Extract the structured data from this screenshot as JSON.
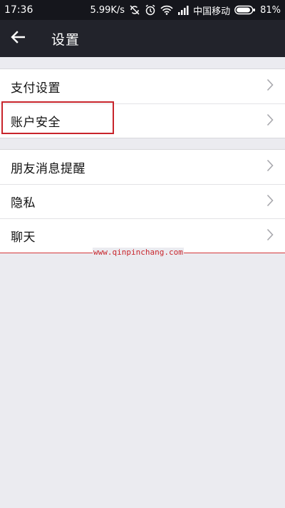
{
  "status_bar": {
    "time": "17:36",
    "speed": "5.99K/s",
    "carrier": "中国移动",
    "battery": "81%",
    "icons": [
      "sync-off-icon",
      "alarm-icon",
      "wifi-icon",
      "signal-icon",
      "battery-icon"
    ]
  },
  "header": {
    "back_icon": "arrow-left-icon",
    "title": "设置"
  },
  "settings_groups": [
    {
      "items": [
        {
          "label": "支付设置"
        },
        {
          "label": "账户安全"
        }
      ]
    },
    {
      "items": [
        {
          "label": "朋友消息提醒"
        },
        {
          "label": "隐私"
        },
        {
          "label": "聊天"
        }
      ]
    }
  ],
  "watermark": "www.qinpinchang.com",
  "colors": {
    "status_bar_bg": "#15161c",
    "title_bar_bg": "#22232b",
    "page_bg": "#ebebf0",
    "highlight": "#c8242b"
  }
}
